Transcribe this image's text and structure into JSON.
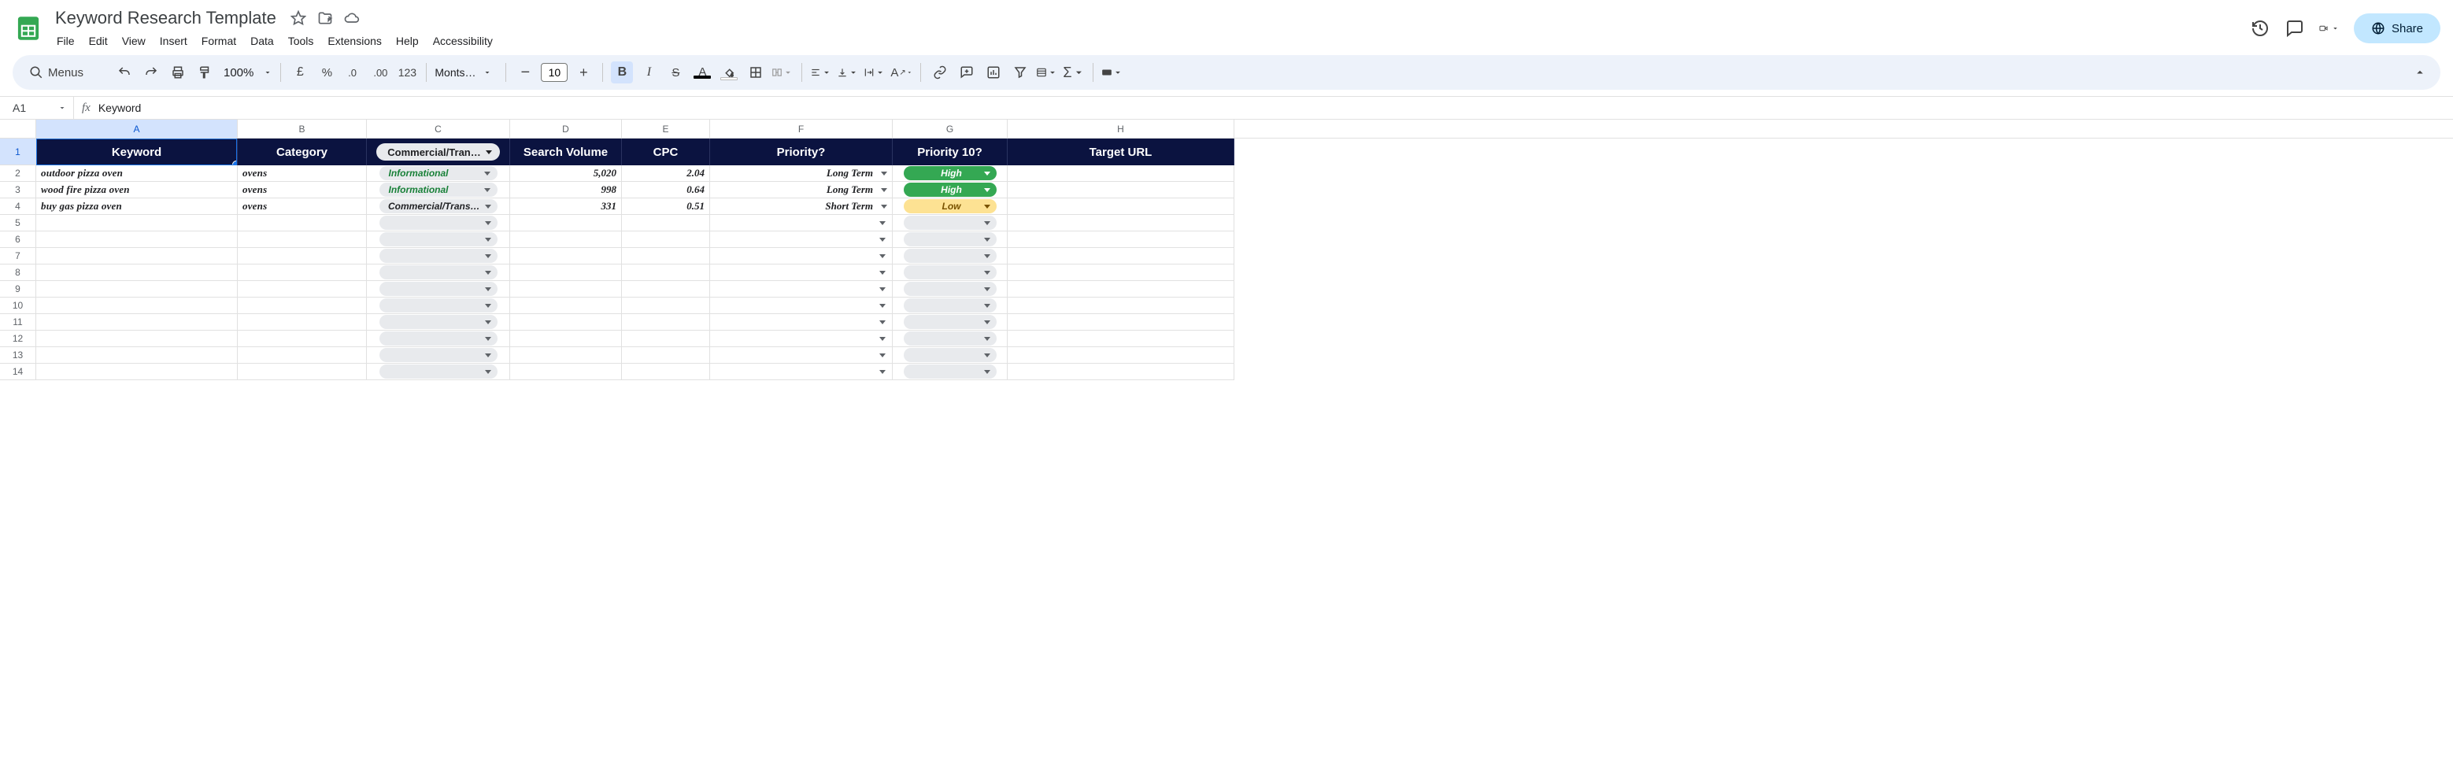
{
  "doc_title": "Keyword Research Template",
  "menu": [
    "File",
    "Edit",
    "View",
    "Insert",
    "Format",
    "Data",
    "Tools",
    "Extensions",
    "Help",
    "Accessibility"
  ],
  "share_label": "Share",
  "toolbar": {
    "search_label": "Menus",
    "zoom": "100%",
    "font": "Monts…",
    "font_size": "10",
    "num_format": "123"
  },
  "namebox": "A1",
  "formula": "Keyword",
  "columns": [
    "A",
    "B",
    "C",
    "D",
    "E",
    "F",
    "G",
    "H"
  ],
  "headers": {
    "A": "Keyword",
    "B": "Category",
    "C_chip": "Commercial/Tran…",
    "D": "Search Volume",
    "E": "CPC",
    "F": "Priority?",
    "G": "Priority 10?",
    "H": "Target URL"
  },
  "rows": [
    {
      "n": 2,
      "keyword": "outdoor pizza oven",
      "category": "ovens",
      "intent": "Informational",
      "intent_style": "info",
      "volume": "5,020",
      "cpc": "2.04",
      "priority": "Long Term",
      "p10": "High",
      "p10_style": "high"
    },
    {
      "n": 3,
      "keyword": "wood fire pizza oven",
      "category": "ovens",
      "intent": "Informational",
      "intent_style": "info",
      "volume": "998",
      "cpc": "0.64",
      "priority": "Long Term",
      "p10": "High",
      "p10_style": "high"
    },
    {
      "n": 4,
      "keyword": "buy gas pizza oven",
      "category": "ovens",
      "intent": "Commercial/Trans…",
      "intent_style": "comm",
      "volume": "331",
      "cpc": "0.51",
      "priority": "Short Term",
      "p10": "Low",
      "p10_style": "low"
    }
  ],
  "empty_rows": [
    5,
    6,
    7,
    8,
    9,
    10,
    11,
    12,
    13,
    14
  ]
}
